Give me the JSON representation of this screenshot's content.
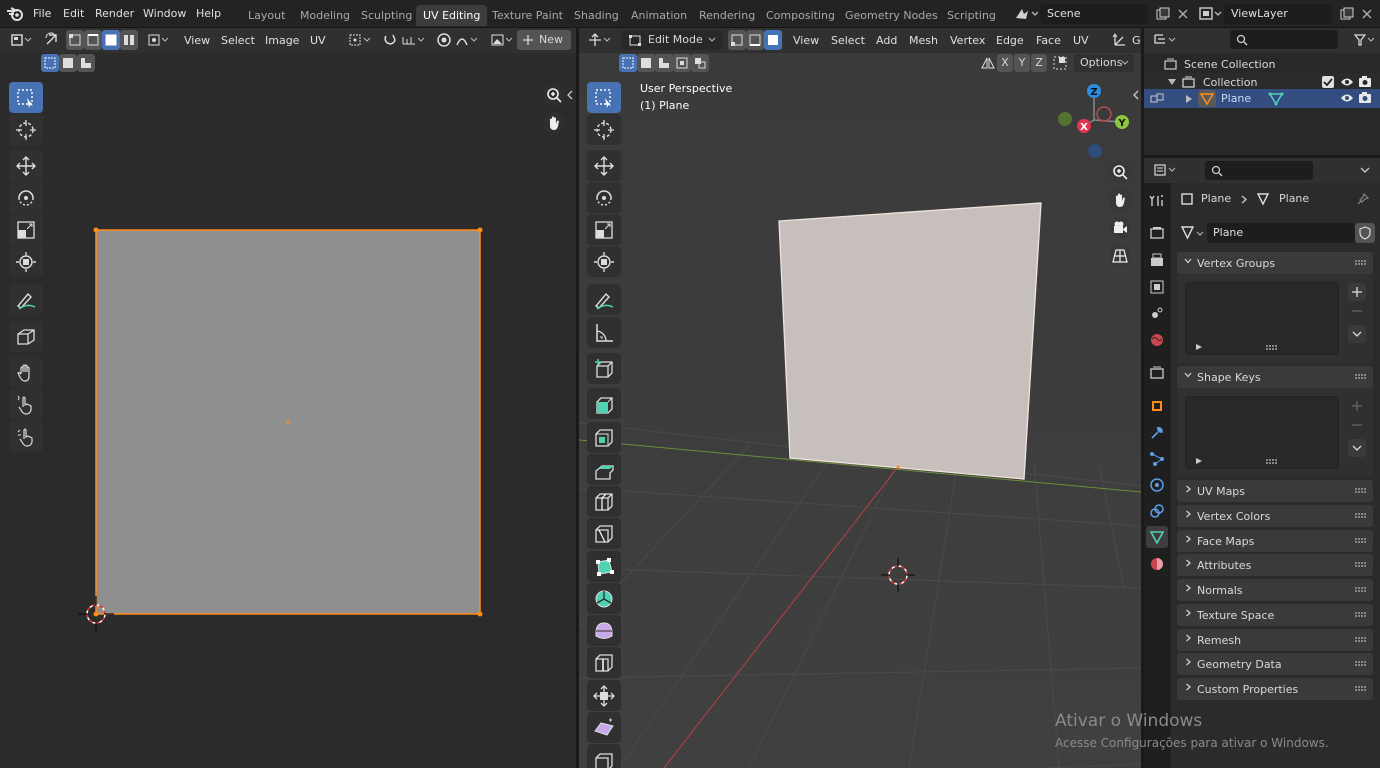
{
  "top_menu": [
    "File",
    "Edit",
    "Render",
    "Window",
    "Help"
  ],
  "workspace_tabs": [
    {
      "label": "Layout"
    },
    {
      "label": "Modeling"
    },
    {
      "label": "Sculpting"
    },
    {
      "label": "UV Editing",
      "active": true
    },
    {
      "label": "Texture Paint"
    },
    {
      "label": "Shading"
    },
    {
      "label": "Animation"
    },
    {
      "label": "Rendering"
    },
    {
      "label": "Compositing"
    },
    {
      "label": "Geometry Nodes"
    },
    {
      "label": "Scripting"
    }
  ],
  "scene_field": "Scene",
  "view_layer_field": "ViewLayer",
  "uv_editor": {
    "menus": [
      "View",
      "Select",
      "Image",
      "UV"
    ],
    "new_label": "New"
  },
  "viewport": {
    "mode": "Edit Mode",
    "menus": [
      "View",
      "Select",
      "Add",
      "Mesh",
      "Vertex",
      "Edge",
      "Face",
      "UV"
    ],
    "truncated_menu": "G",
    "axes": [
      "X",
      "Y",
      "Z"
    ],
    "options_label": "Options",
    "overlay_title": "User Perspective",
    "overlay_object": "(1) Plane",
    "gizmo": {
      "x": "X",
      "y": "Y",
      "z": "Z",
      "colors": {
        "x": "#e2364e",
        "y": "#8bc541",
        "z": "#2b8ee3"
      }
    }
  },
  "outliner": {
    "items": [
      {
        "label": "Scene Collection"
      },
      {
        "label": "Collection"
      },
      {
        "label": "Plane",
        "selected": true
      }
    ]
  },
  "properties": {
    "breadcrumb": [
      "Plane",
      "Plane"
    ],
    "mesh_name": "Plane",
    "panels": [
      "Vertex Groups",
      "Shape Keys",
      "UV Maps",
      "Vertex Colors",
      "Face Maps",
      "Attributes",
      "Normals",
      "Texture Space",
      "Remesh",
      "Geometry Data",
      "Custom Properties"
    ]
  },
  "watermark": {
    "title": "Ativar o Windows",
    "subtitle": "Acesse Configurações para ativar o Windows."
  },
  "colors": {
    "accent": "#4772b3",
    "selection": "#ff8c1a",
    "mesh_data": "#4fd1b4"
  }
}
